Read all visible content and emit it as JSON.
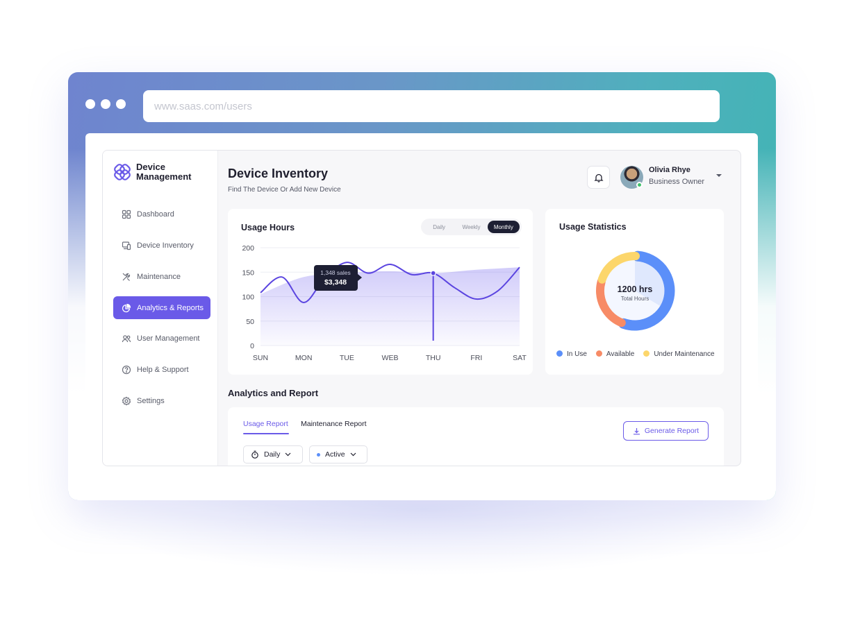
{
  "browser": {
    "url": "www.saas.com/users"
  },
  "sidebar": {
    "brand_line1": "Device",
    "brand_line2": "Management",
    "items": [
      {
        "label": "Dashboard",
        "icon": "grid-icon"
      },
      {
        "label": "Device Inventory",
        "icon": "devices-icon"
      },
      {
        "label": "Maintenance",
        "icon": "tools-icon"
      },
      {
        "label": "Analytics & Reports",
        "icon": "pie-chart-icon",
        "active": true
      },
      {
        "label": "User Management",
        "icon": "users-icon"
      },
      {
        "label": "Help & Support",
        "icon": "help-icon"
      },
      {
        "label": "Settings",
        "icon": "gear-icon"
      }
    ]
  },
  "header": {
    "title": "Device Inventory",
    "subtitle": "Find The Device Or Add New Device",
    "user_name": "Olivia Rhye",
    "user_role": "Business Owner"
  },
  "usage": {
    "title": "Usage Hours",
    "periods": [
      "Daily",
      "Weekly",
      "Monthly"
    ],
    "selected_period": "Monthly",
    "tooltip_line1": "1,348 sales",
    "tooltip_line2": "$3,348"
  },
  "stats": {
    "title": "Usage Statistics",
    "total_value": "1200 hrs",
    "total_label": "Total Hours",
    "legend": [
      {
        "label": "In Use",
        "color": "#5b8ff9"
      },
      {
        "label": "Available",
        "color": "#f78b66"
      },
      {
        "label": "Under Maintenance",
        "color": "#fcd66b"
      }
    ]
  },
  "reports": {
    "section_title": "Analytics and Report",
    "tabs": [
      "Usage Report",
      "Maintenance Report"
    ],
    "active_tab": "Usage Report",
    "generate_label": "Generate Report",
    "filter_period": "Daily",
    "filter_status": "Active"
  },
  "colors": {
    "accent": "#6a5ae8",
    "line": "#5b45e0",
    "in_use": "#5b8ff9",
    "available": "#f78b66",
    "maintenance": "#fcd66b"
  },
  "chart_data": [
    {
      "type": "area",
      "title": "Usage Hours",
      "categories": [
        "SUN",
        "MON",
        "TUE",
        "WEB",
        "THU",
        "FRI",
        "SAT"
      ],
      "yticks": [
        0,
        50,
        100,
        150,
        200
      ],
      "ylim": [
        0,
        200
      ],
      "grid": true,
      "series": [
        {
          "kind": "line",
          "x": [
            0,
            0.5,
            1,
            1.5,
            2,
            2.5,
            3,
            3.5,
            4,
            4.5,
            5,
            5.5,
            6
          ],
          "values": [
            108,
            140,
            88,
            140,
            170,
            148,
            166,
            145,
            148,
            118,
            95,
            112,
            160
          ]
        },
        {
          "kind": "area",
          "x": [
            0,
            1,
            2,
            3,
            4,
            5,
            6
          ],
          "values": [
            105,
            140,
            148,
            152,
            148,
            155,
            160
          ]
        }
      ],
      "highlight": {
        "category": "THU",
        "value": 148
      }
    },
    {
      "type": "pie",
      "title": "Usage Statistics",
      "categories": [
        "In Use",
        "Available",
        "Under Maintenance"
      ],
      "values": [
        55,
        24,
        21
      ]
    }
  ]
}
